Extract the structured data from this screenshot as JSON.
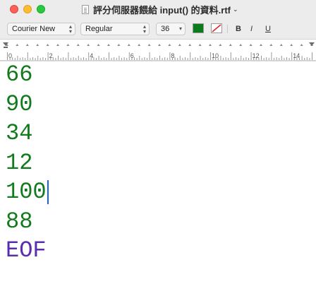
{
  "window": {
    "title": "評分伺服器餵給 input() 的資料.rtf",
    "title_chevron": "⌄"
  },
  "toolbar": {
    "font_family": "Courier New",
    "font_style": "Regular",
    "font_size": "36",
    "text_color": "#0a7a1a",
    "bold_label": "B",
    "italic_label": "I",
    "underline_label": "U"
  },
  "ruler": {
    "labels": [
      "0",
      "2",
      "4",
      "6",
      "8",
      "10",
      "12",
      "14"
    ]
  },
  "document": {
    "lines": [
      "66",
      "90",
      "34",
      "12",
      "100",
      "88",
      "EOF"
    ],
    "text_color": "#117a1c",
    "eof_color": "#5b2cb0",
    "caret_line_index": 4
  }
}
